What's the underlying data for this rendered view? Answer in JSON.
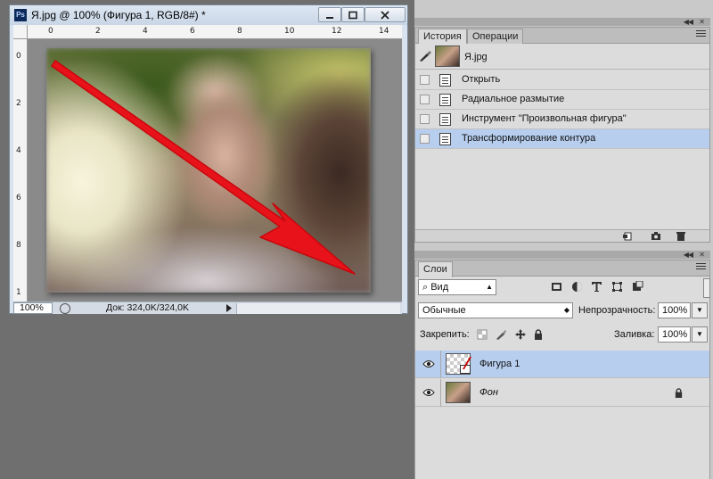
{
  "document": {
    "title": "Я.jpg @ 100% (Фигура 1, RGB/8#) *",
    "app_icon": "Ps",
    "ruler_h": [
      "0",
      "2",
      "4",
      "6",
      "8",
      "10",
      "12",
      "14"
    ],
    "ruler_v": [
      "0",
      "2",
      "4",
      "6",
      "8",
      "1"
    ],
    "zoom": "100%",
    "doc_info": "Док: 324,0K/324,0K"
  },
  "history_panel": {
    "tabs": [
      "История",
      "Операции"
    ],
    "snapshot_name": "Я.jpg",
    "steps": [
      {
        "label": "Открыть",
        "selected": false
      },
      {
        "label": "Радиальное размытие",
        "selected": false
      },
      {
        "label": "Инструмент \"Произвольная фигура\"",
        "selected": false
      },
      {
        "label": "Трансформирование контура",
        "selected": true
      }
    ]
  },
  "layers_panel": {
    "tab": "Слои",
    "filter_kind": "Вид",
    "blend_mode": "Обычные",
    "opacity_label": "Непрозрачность:",
    "opacity_value": "100%",
    "lock_label": "Закрепить:",
    "fill_label": "Заливка:",
    "fill_value": "100%",
    "layers": [
      {
        "name": "Фигура 1",
        "selected": true,
        "italic": false
      },
      {
        "name": "Фон",
        "selected": false,
        "italic": true
      }
    ]
  },
  "colors": {
    "arrow": "#e8131a",
    "selection": "#b7ceee"
  }
}
